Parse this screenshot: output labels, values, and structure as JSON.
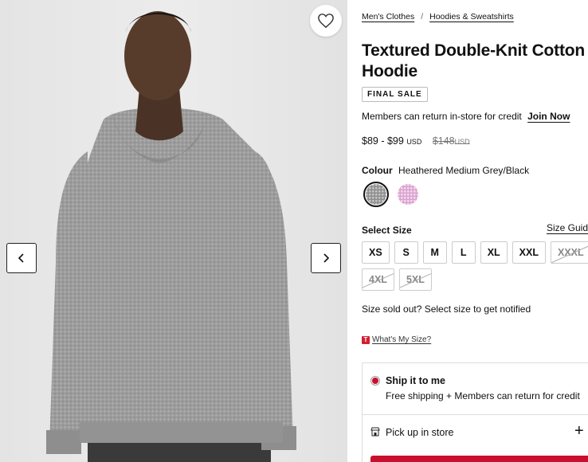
{
  "breadcrumb": [
    "Men's Clothes",
    "/",
    "Hoodies & Sweatshirts"
  ],
  "product": {
    "title": "Textured Double-Knit Cotton Hoodie",
    "badge": "FINAL SALE",
    "member_text": "Members can return in-store for credit",
    "join_label": "Join Now",
    "price_range": "$89 - $99",
    "price_currency": "USD",
    "old_price": "$148",
    "old_currency": "USD"
  },
  "colour": {
    "label": "Colour",
    "selected_name": "Heathered Medium Grey/Black",
    "swatches": [
      {
        "name": "heathered-grey",
        "color": "#9a9a9a",
        "selected": true
      },
      {
        "name": "pink-heather",
        "color": "#e2b5d8",
        "selected": false
      }
    ]
  },
  "size": {
    "label": "Select Size",
    "guide_label": "Size Guid",
    "options": [
      {
        "label": "XS",
        "sold_out": false
      },
      {
        "label": "S",
        "sold_out": false
      },
      {
        "label": "M",
        "sold_out": false
      },
      {
        "label": "L",
        "sold_out": false
      },
      {
        "label": "XL",
        "sold_out": false
      },
      {
        "label": "XXL",
        "sold_out": false
      },
      {
        "label": "XXXL",
        "sold_out": true
      },
      {
        "label": "4XL",
        "sold_out": true
      },
      {
        "label": "5XL",
        "sold_out": true
      }
    ],
    "sold_out_note": "Size sold out? Select size to get notified",
    "whats_my_size_badge": "T",
    "whats_my_size": "What's My Size?"
  },
  "fulfillment": {
    "ship_title": "Ship it to me",
    "ship_sub": "Free shipping + Members can return for credit",
    "pickup_title": "Pick up in store",
    "pickup_action": "+"
  },
  "icons": {
    "favorite": "heart-icon",
    "prev": "chevron-left-icon",
    "next": "chevron-right-icon",
    "store": "store-icon"
  },
  "colors": {
    "accent": "#c8102e",
    "background_image": "#e8e8e8",
    "hoodie": "#9a9a9a"
  }
}
